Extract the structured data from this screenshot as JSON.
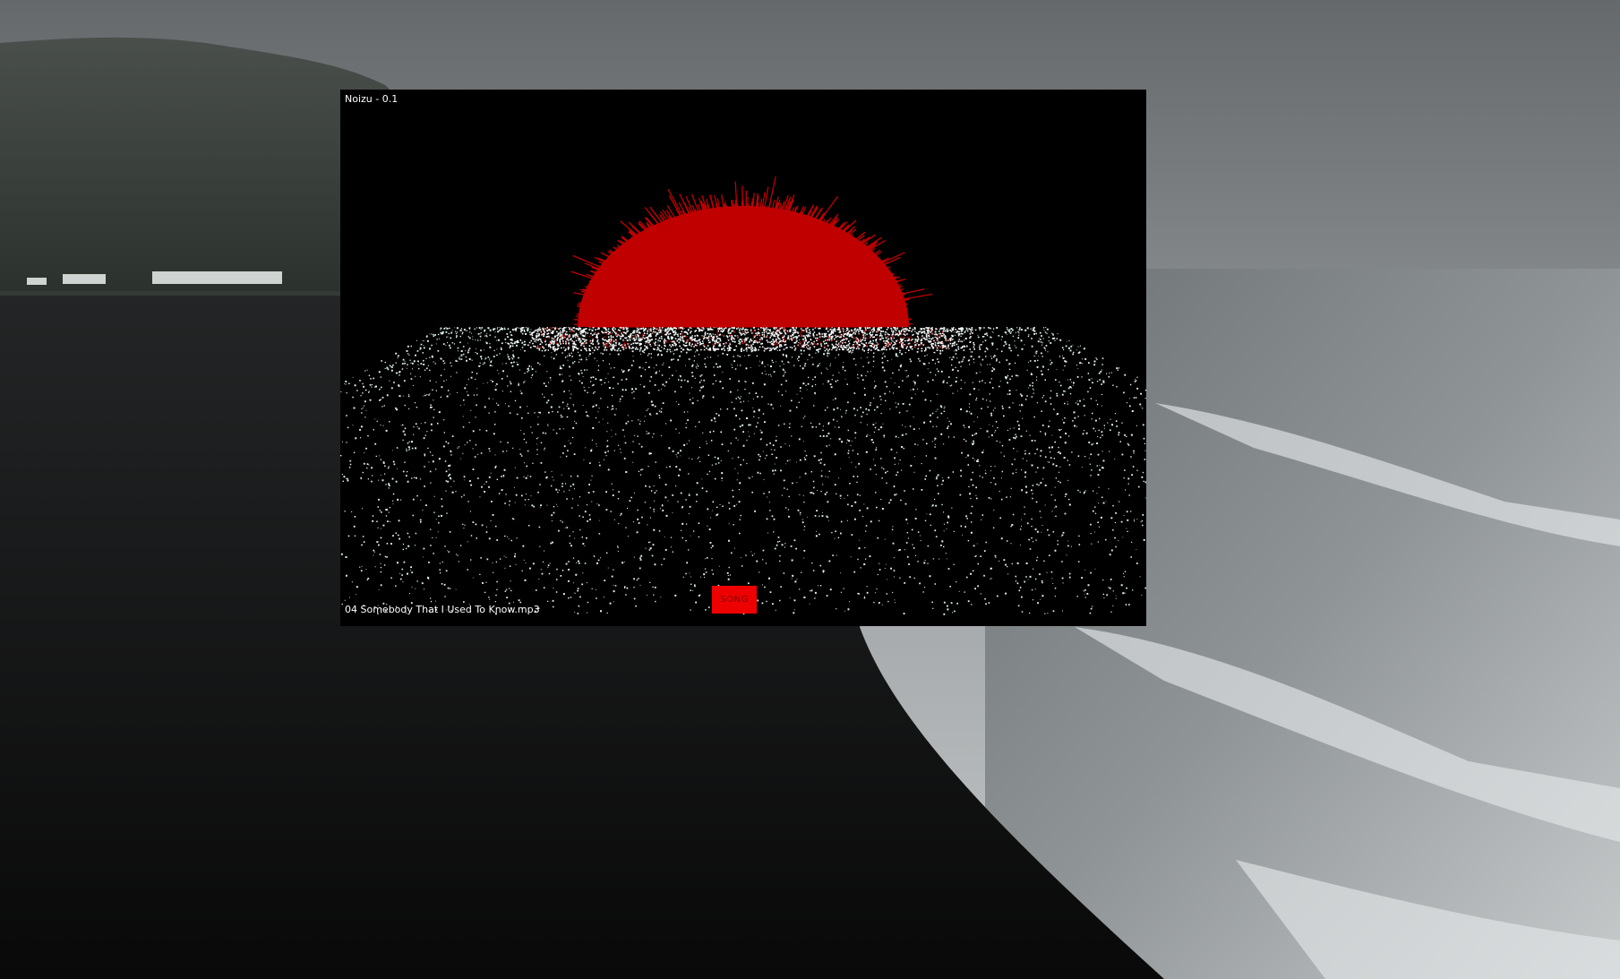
{
  "window": {
    "title": "Noizu - 0.1"
  },
  "player": {
    "current_track": "04 Somebody That I Used To Know.mp3",
    "song_button_label": "SONG"
  },
  "colors": {
    "visualizer_background": "#000000",
    "sun_red": "#c00000",
    "particle_white": "#dff5ee",
    "button_red": "#ee0000"
  },
  "icons": {
    "sun": "radial-spectrum-bars",
    "particles": "particle-field"
  }
}
